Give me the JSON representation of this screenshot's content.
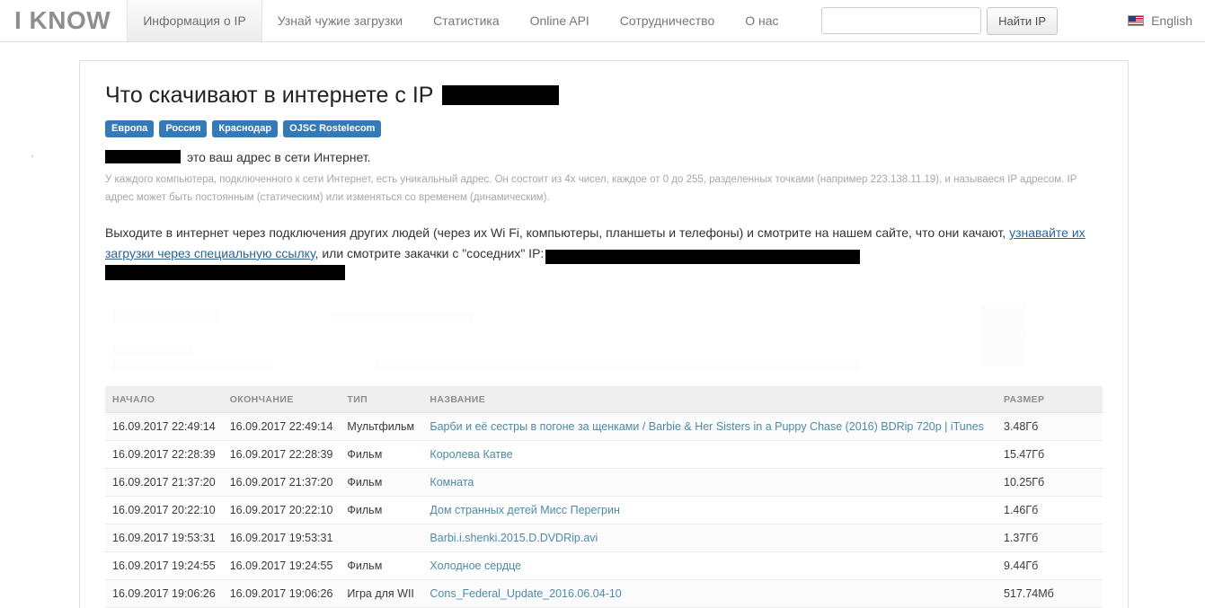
{
  "navbar": {
    "brand": "I KNOW",
    "items": [
      {
        "label": "Информация о IP",
        "active": true
      },
      {
        "label": "Узнай чужие загрузки",
        "active": false
      },
      {
        "label": "Статистика",
        "active": false
      },
      {
        "label": "Online API",
        "active": false
      },
      {
        "label": "Сотрудничество",
        "active": false
      },
      {
        "label": "О нас",
        "active": false
      }
    ],
    "search": {
      "value": "",
      "placeholder": ""
    },
    "find_button": "Найти IP",
    "language": "English",
    "flag_icon": "us-flag-icon"
  },
  "main": {
    "title": "Что скачивают в интернете с IP",
    "badges": [
      "Европа",
      "Россия",
      "Краснодар",
      "OJSC Rostelecom"
    ],
    "address_line": "это ваш адрес в сети Интернет.",
    "description": "У каждого компьютера, подключенного к сети Интернет, есть уникальный адрес. Он состоит из 4х чисел, каждое от 0 до 255, разделенных точками (например 223.138.11.19), и называеся IP адресом. IP адрес может быть постоянным (статическим) или изменяться со временем (динамическим).",
    "lead_part1": "Выходите в интернет через подключения других людей (через их Wi Fi, компьютеры, планшеты и телефоны) и смотрите на нашем сайте, что они качают, ",
    "lead_link": "узнавайте их загрузки через специальную ссылку",
    "lead_part2": ", или смотрите закачки с \"соседних\" IP:",
    "stray_mark": "'"
  },
  "table": {
    "headers": [
      "НАЧАЛО",
      "ОКОНЧАНИЕ",
      "ТИП",
      "НАЗВАНИЕ",
      "РАЗМЕР"
    ],
    "rows": [
      {
        "start": "16.09.2017 22:49:14",
        "end": "16.09.2017 22:49:14",
        "type": "Мультфильм",
        "name": "Барби и её сестры в погоне за щенками / Barbie & Her Sisters in a Puppy Chase (2016) BDRip 720p | iTunes",
        "size": "3.48Гб"
      },
      {
        "start": "16.09.2017 22:28:39",
        "end": "16.09.2017 22:28:39",
        "type": "Фильм",
        "name": "Королева Катве",
        "size": "15.47Гб"
      },
      {
        "start": "16.09.2017 21:37:20",
        "end": "16.09.2017 21:37:20",
        "type": "Фильм",
        "name": "Комната",
        "size": "10.25Гб"
      },
      {
        "start": "16.09.2017 20:22:10",
        "end": "16.09.2017 20:22:10",
        "type": "Фильм",
        "name": "Дом странных детей Мисс Перегрин",
        "size": "1.46Гб"
      },
      {
        "start": "16.09.2017 19:53:31",
        "end": "16.09.2017 19:53:31",
        "type": "",
        "name": "Barbi.i.shenki.2015.D.DVDRip.avi",
        "size": "1.37Гб"
      },
      {
        "start": "16.09.2017 19:24:55",
        "end": "16.09.2017 19:24:55",
        "type": "Фильм",
        "name": "Холодное сердце",
        "size": "9.44Гб"
      },
      {
        "start": "16.09.2017 19:06:26",
        "end": "16.09.2017 19:06:26",
        "type": "Игра для WII",
        "name": "Cons_Federal_Update_2016.06.04-10",
        "size": "517.74Мб"
      }
    ]
  },
  "colors": {
    "badge": "#337ab7",
    "link": "#4d8ba5",
    "lead_link": "#2a6496",
    "header_text": "#8d8d8d"
  }
}
